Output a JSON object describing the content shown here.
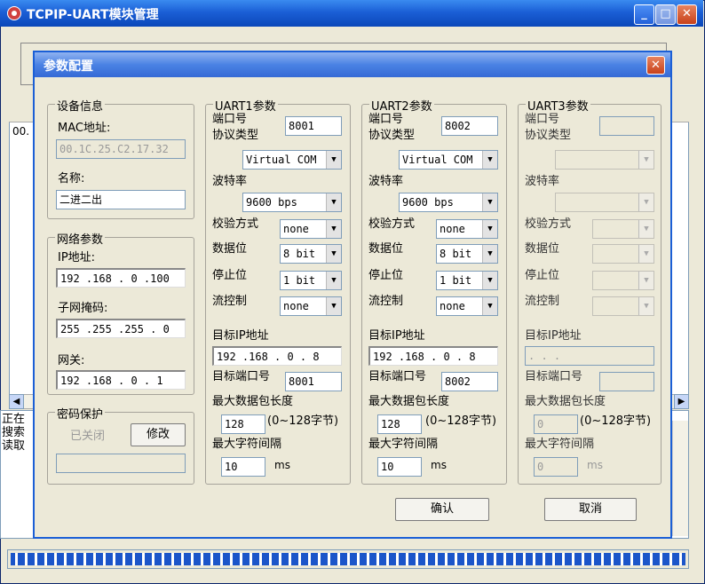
{
  "main_window": {
    "title": "TCPIP-UART模块管理",
    "buttons": {
      "minimize": "_",
      "maximize": "□",
      "close": "✕"
    },
    "list_cell": "00.",
    "log_lines": [
      "正在",
      "搜索",
      "读取"
    ]
  },
  "dialog": {
    "title": "参数配置",
    "close": "✕",
    "device_info": {
      "group_label": "设备信息",
      "mac_label": "MAC地址:",
      "mac_value": "00.1C.25.C2.17.32",
      "name_label": "名称:",
      "name_value": "二进二出"
    },
    "network": {
      "group_label": "网络参数",
      "ip_label": "IP地址:",
      "ip_value": "192 .168 . 0  .100",
      "mask_label": "子网掩码:",
      "mask_value": "255 .255 .255 . 0",
      "gateway_label": "网关:",
      "gateway_value": "192 .168 . 0  . 1"
    },
    "password": {
      "group_label": "密码保护",
      "status_label": "已关闭",
      "modify_button": "修改",
      "input_value": ""
    },
    "labels": {
      "port": "端口号",
      "protocol": "协议类型",
      "baud": "波特率",
      "parity": "校验方式",
      "data_bits": "数据位",
      "stop_bits": "停止位",
      "flow": "流控制",
      "target_ip": "目标IP地址",
      "target_port": "目标端口号",
      "max_packet": "最大数据包长度",
      "max_packet_unit": "(0~128字节)",
      "max_interval": "最大字符间隔",
      "ms": "ms"
    },
    "uart1": {
      "group_label": "UART1参数",
      "port": "8001",
      "protocol": "Virtual COM",
      "baud": "9600 bps",
      "parity": "none",
      "data_bits": "8 bit",
      "stop_bits": "1 bit",
      "flow": "none",
      "target_ip": "192 .168 . 0  . 8",
      "target_port": "8001",
      "max_packet": "128",
      "max_interval": "10"
    },
    "uart2": {
      "group_label": "UART2参数",
      "port": "8002",
      "protocol": "Virtual COM",
      "baud": "9600 bps",
      "parity": "none",
      "data_bits": "8 bit",
      "stop_bits": "1 bit",
      "flow": "none",
      "target_ip": "192 .168 . 0  . 8",
      "target_port": "8002",
      "max_packet": "128",
      "max_interval": "10"
    },
    "uart3": {
      "group_label": "UART3参数",
      "port": "",
      "protocol": "",
      "baud": "",
      "parity": "",
      "data_bits": "",
      "stop_bits": "",
      "flow": "",
      "target_ip": " .     .     .",
      "target_port": "",
      "max_packet": "0",
      "max_interval": "0"
    },
    "buttons": {
      "ok": "确认",
      "cancel": "取消"
    }
  }
}
